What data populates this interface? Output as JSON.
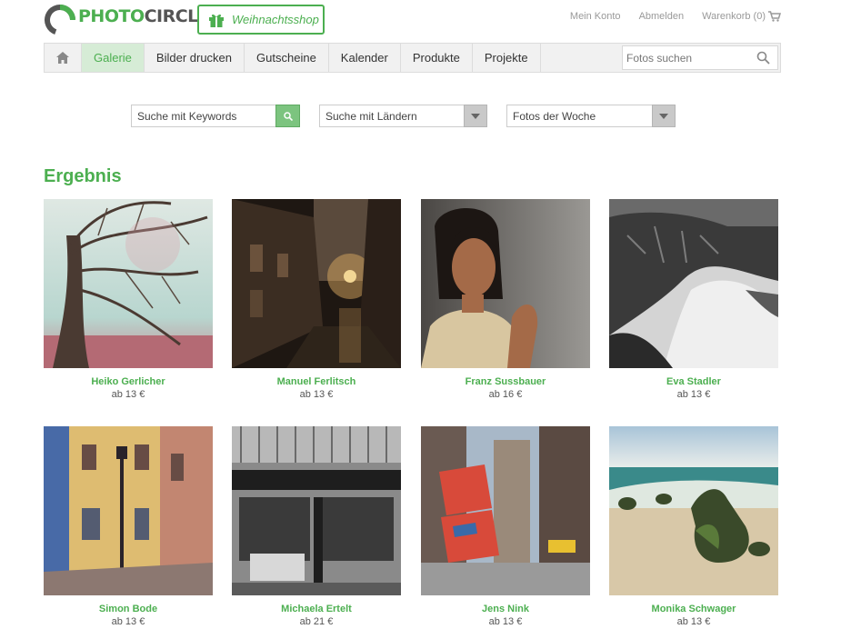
{
  "logo": {
    "part1": "PHOTO",
    "part2": "CIRCLE"
  },
  "header": {
    "xmas_label": "Weihnachtsshop",
    "account": "Mein Konto",
    "logout": "Abmelden",
    "cart": "Warenkorb (0)"
  },
  "nav": {
    "items": [
      "Galerie",
      "Bilder drucken",
      "Gutscheine",
      "Kalender",
      "Produkte",
      "Projekte"
    ],
    "search_placeholder": "Fotos suchen"
  },
  "filters": {
    "keywords_placeholder": "Suche mit Keywords",
    "countries": "Suche mit Ländern",
    "weekly": "Fotos der Woche"
  },
  "results": {
    "heading": "Ergebnis",
    "items": [
      {
        "photographer": "Heiko Gerlicher",
        "price": "ab 13 €"
      },
      {
        "photographer": "Manuel Ferlitsch",
        "price": "ab 13 €"
      },
      {
        "photographer": "Franz Sussbauer",
        "price": "ab 16 €"
      },
      {
        "photographer": "Eva Stadler",
        "price": "ab 13 €"
      },
      {
        "photographer": "Simon Bode",
        "price": "ab 13 €"
      },
      {
        "photographer": "Michaela Ertelt",
        "price": "ab 21 €"
      },
      {
        "photographer": "Jens Nink",
        "price": "ab 13 €"
      },
      {
        "photographer": "Monika Schwager",
        "price": "ab 13 €"
      }
    ]
  },
  "colors": {
    "accent": "#4caf50",
    "nav_bg": "#f1f1f1",
    "nav_active": "#d6ecd6"
  }
}
